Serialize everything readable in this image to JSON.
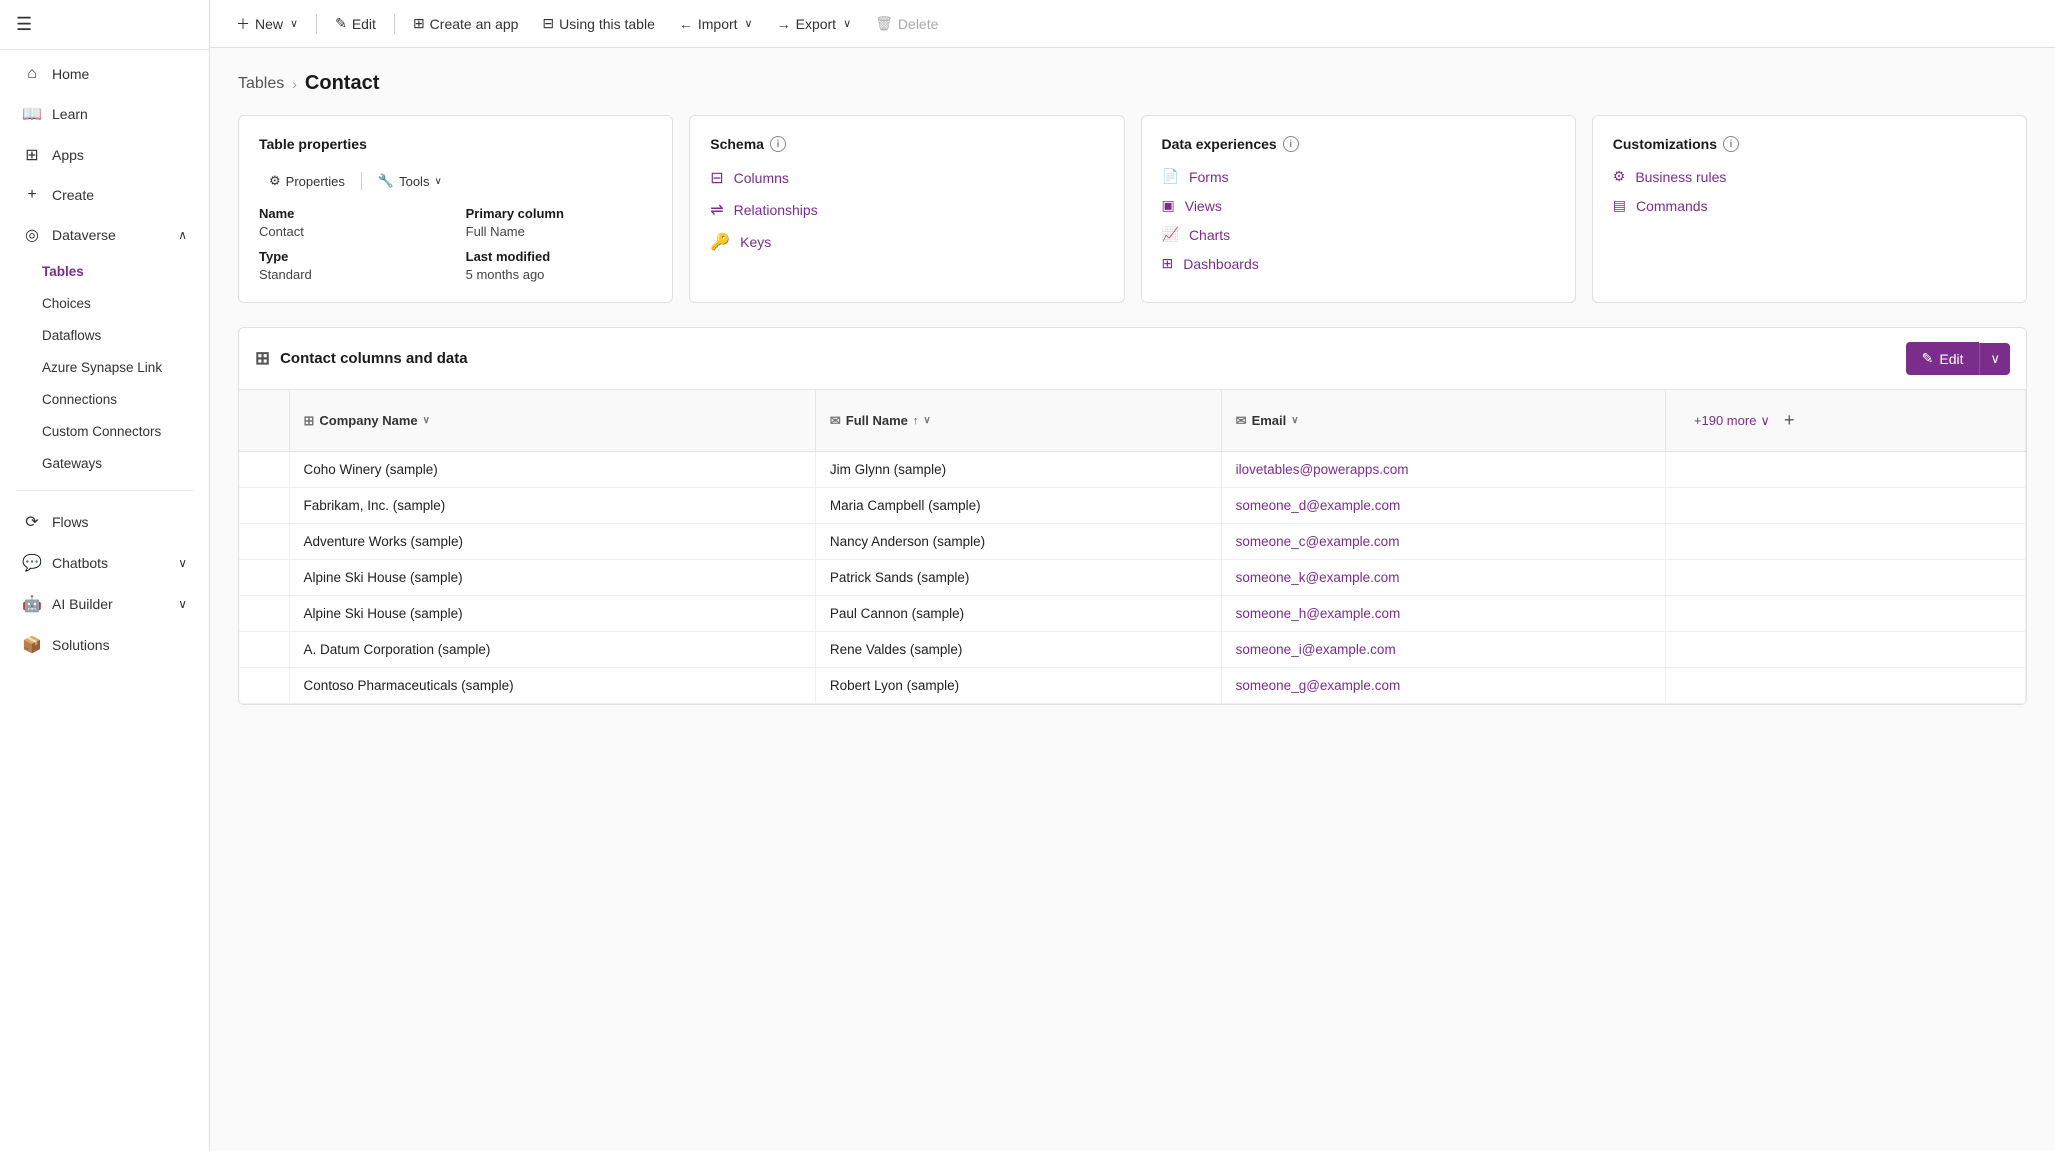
{
  "sidebar": {
    "hamburger_icon": "☰",
    "items": [
      {
        "id": "home",
        "label": "Home",
        "icon": "⌂",
        "active": false
      },
      {
        "id": "learn",
        "label": "Learn",
        "icon": "📖",
        "active": false
      },
      {
        "id": "apps",
        "label": "Apps",
        "icon": "⊞",
        "active": false
      },
      {
        "id": "create",
        "label": "Create",
        "icon": "+",
        "active": false
      },
      {
        "id": "dataverse",
        "label": "Dataverse",
        "icon": "◎",
        "active": true,
        "expandable": true,
        "expanded": true
      }
    ],
    "dataverse_sub": [
      {
        "id": "tables",
        "label": "Tables",
        "active": true
      },
      {
        "id": "choices",
        "label": "Choices",
        "active": false
      },
      {
        "id": "dataflows",
        "label": "Dataflows",
        "active": false
      },
      {
        "id": "azure-synapse",
        "label": "Azure Synapse Link",
        "active": false
      },
      {
        "id": "connections",
        "label": "Connections",
        "active": false
      },
      {
        "id": "custom-connectors",
        "label": "Custom Connectors",
        "active": false
      },
      {
        "id": "gateways",
        "label": "Gateways",
        "active": false
      }
    ],
    "bottom_items": [
      {
        "id": "flows",
        "label": "Flows",
        "icon": "⟳",
        "active": false
      },
      {
        "id": "chatbots",
        "label": "Chatbots",
        "icon": "💬",
        "active": false,
        "expandable": true
      },
      {
        "id": "ai-builder",
        "label": "AI Builder",
        "icon": "🤖",
        "active": false,
        "expandable": true
      },
      {
        "id": "solutions",
        "label": "Solutions",
        "icon": "📦",
        "active": false
      }
    ]
  },
  "toolbar": {
    "new_label": "New",
    "edit_label": "Edit",
    "create_app_label": "Create an app",
    "using_table_label": "Using this table",
    "import_label": "Import",
    "export_label": "Export",
    "delete_label": "Delete"
  },
  "breadcrumb": {
    "parent_label": "Tables",
    "separator": "›",
    "current_label": "Contact"
  },
  "table_properties_card": {
    "title": "Table properties",
    "properties_btn": "Properties",
    "tools_btn": "Tools",
    "name_label": "Name",
    "name_value": "Contact",
    "primary_column_label": "Primary column",
    "primary_column_value": "Full Name",
    "type_label": "Type",
    "type_value": "Standard",
    "last_modified_label": "Last modified",
    "last_modified_value": "5 months ago"
  },
  "schema_card": {
    "title": "Schema",
    "links": [
      {
        "id": "columns",
        "label": "Columns",
        "icon": "⊟"
      },
      {
        "id": "relationships",
        "label": "Relationships",
        "icon": "⇌"
      },
      {
        "id": "keys",
        "label": "Keys",
        "icon": "🔑"
      }
    ]
  },
  "data_experiences_card": {
    "title": "Data experiences",
    "links": [
      {
        "id": "forms",
        "label": "Forms",
        "icon": "📄"
      },
      {
        "id": "views",
        "label": "Views",
        "icon": "▣"
      },
      {
        "id": "charts",
        "label": "Charts",
        "icon": "📈"
      },
      {
        "id": "dashboards",
        "label": "Dashboards",
        "icon": "⊞"
      }
    ]
  },
  "customizations_card": {
    "title": "Customizations",
    "links": [
      {
        "id": "business-rules",
        "label": "Business rules",
        "icon": "⚙"
      },
      {
        "id": "commands",
        "label": "Commands",
        "icon": "▤"
      }
    ]
  },
  "data_section": {
    "title": "Contact columns and data",
    "edit_btn": "Edit",
    "columns": [
      {
        "id": "checkbox",
        "label": ""
      },
      {
        "id": "company-name",
        "label": "Company Name",
        "icon": "⊞",
        "sortable": true,
        "sort_dir": ""
      },
      {
        "id": "full-name",
        "label": "Full Name",
        "icon": "✉",
        "sortable": true,
        "sort_dir": "↑"
      },
      {
        "id": "email",
        "label": "Email",
        "icon": "✉",
        "sortable": true,
        "sort_dir": ""
      },
      {
        "id": "more",
        "label": "+190 more",
        "is_more": true
      }
    ],
    "rows": [
      {
        "id": 1,
        "company": "Coho Winery (sample)",
        "full_name": "Jim Glynn (sample)",
        "email": "ilovetables@powerapps.com"
      },
      {
        "id": 2,
        "company": "Fabrikam, Inc. (sample)",
        "full_name": "Maria Campbell (sample)",
        "email": "someone_d@example.com"
      },
      {
        "id": 3,
        "company": "Adventure Works (sample)",
        "full_name": "Nancy Anderson (sample)",
        "email": "someone_c@example.com"
      },
      {
        "id": 4,
        "company": "Alpine Ski House (sample)",
        "full_name": "Patrick Sands (sample)",
        "email": "someone_k@example.com"
      },
      {
        "id": 5,
        "company": "Alpine Ski House (sample)",
        "full_name": "Paul Cannon (sample)",
        "email": "someone_h@example.com"
      },
      {
        "id": 6,
        "company": "A. Datum Corporation (sample)",
        "full_name": "Rene Valdes (sample)",
        "email": "someone_i@example.com"
      },
      {
        "id": 7,
        "company": "Contoso Pharmaceuticals (sample)",
        "full_name": "Robert Lyon (sample)",
        "email": "someone_g@example.com"
      }
    ]
  },
  "colors": {
    "accent": "#7b2d8b",
    "accent_hover": "#6a2578"
  }
}
